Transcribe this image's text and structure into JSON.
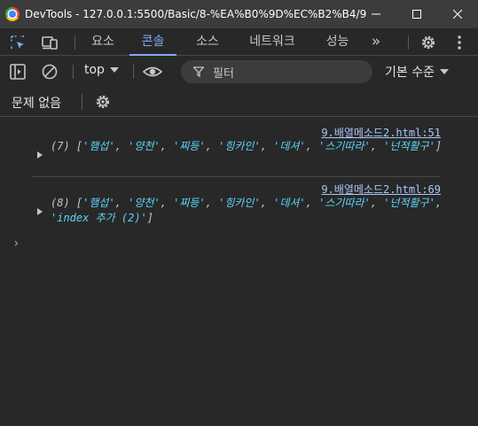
{
  "window": {
    "title": "DevTools - 127.0.0.1:5500/Basic/8-%EA%B0%9D%EC%B2%B4/9.%E..."
  },
  "tabs": {
    "items": [
      "요소",
      "콘솔",
      "소스",
      "네트워크",
      "성능"
    ],
    "active": "콘솔",
    "more_label": "»"
  },
  "toolbar": {
    "context": "top",
    "filter_placeholder": "필터",
    "level_label": "기본 수준"
  },
  "issues": {
    "label": "문제 없음"
  },
  "console": {
    "messages": [
      {
        "source": "9.배열메소드2.html:51",
        "count": "(7)",
        "items": [
          "'햄섭'",
          "'양천'",
          "'찌등'",
          "'힝카인'",
          "'데셔'",
          "'스기따라'",
          "'넌적활구'"
        ]
      },
      {
        "source": "9.배열메소드2.html:69",
        "count": "(8)",
        "items": [
          "'햄섭'",
          "'양천'",
          "'찌등'",
          "'힝카인'",
          "'데셔'",
          "'스기따라'",
          "'넌적활구'",
          "'index 추가 (2)'"
        ]
      }
    ],
    "prompt_symbol": "›"
  }
}
